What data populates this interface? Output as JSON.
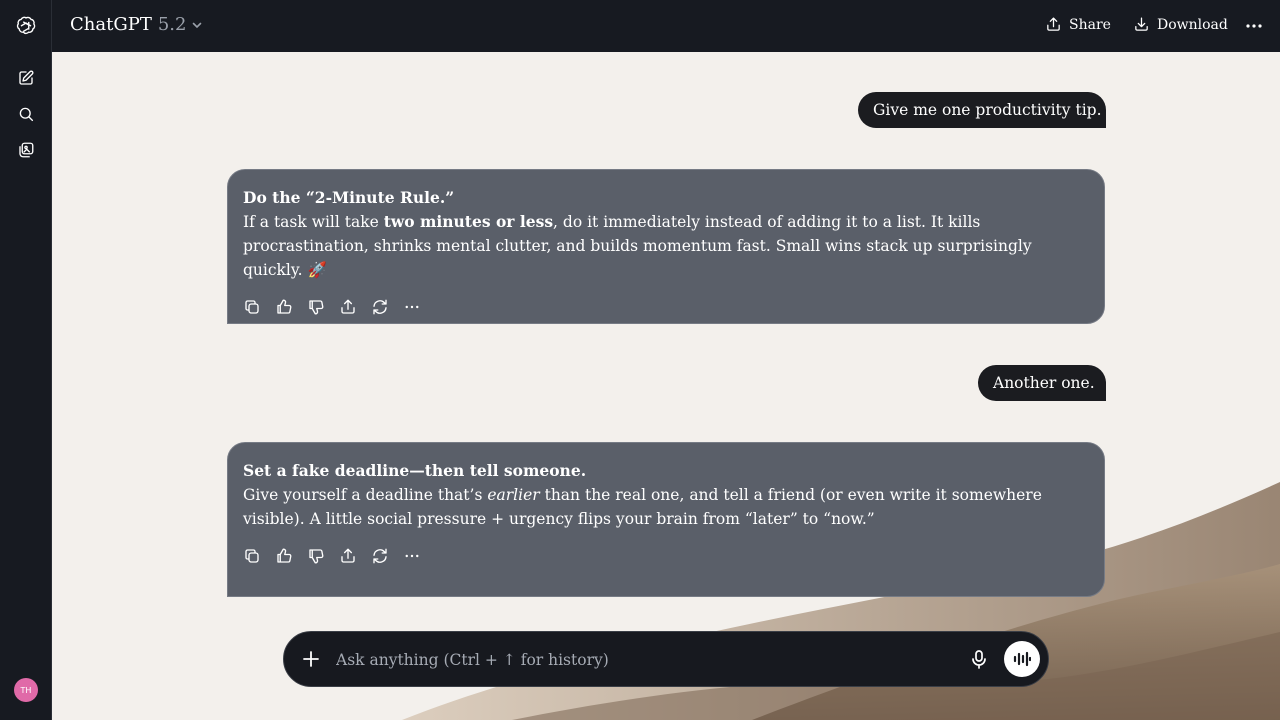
{
  "header": {
    "model_name": "ChatGPT",
    "model_version": "5.2",
    "share_label": "Share",
    "download_label": "Download"
  },
  "sidebar": {
    "items": [
      {
        "icon": "new-chat-icon"
      },
      {
        "icon": "search-icon"
      },
      {
        "icon": "library-icon"
      }
    ],
    "avatar_initials": "TH",
    "avatar_color": "#e06aa8"
  },
  "conversation": {
    "messages": [
      {
        "role": "user",
        "text": "Give me one productivity tip."
      },
      {
        "role": "assistant",
        "heading": "Do the “2-Minute Rule.”",
        "body_pre": "If a task will take ",
        "body_bold": "two minutes or less",
        "body_post": ", do it immediately instead of adding it to a list. It kills procrastination, shrinks mental clutter, and builds momentum fast. Small wins stack up surprisingly quickly. 🚀"
      },
      {
        "role": "user",
        "text": "Another one."
      },
      {
        "role": "assistant",
        "heading": "Set a fake deadline—then tell someone.",
        "body_pre": "Give yourself a deadline that’s ",
        "body_italic": "earlier",
        "body_post": " than the real one, and tell a friend (or even write it somewhere visible). A little social pressure + urgency flips your brain from “later” to “now.”"
      }
    ],
    "action_icons": [
      "copy-icon",
      "thumbs-up-icon",
      "thumbs-down-icon",
      "share-icon",
      "regenerate-icon",
      "more-icon"
    ]
  },
  "composer": {
    "placeholder": "Ask anything (Ctrl + ↑ for history)",
    "value": ""
  },
  "colors": {
    "sidebar_bg": "#171a21",
    "assistant_bubble": "#5a5f69",
    "user_bubble": "#1b1c20",
    "page_bg": "#f3f0ec"
  }
}
